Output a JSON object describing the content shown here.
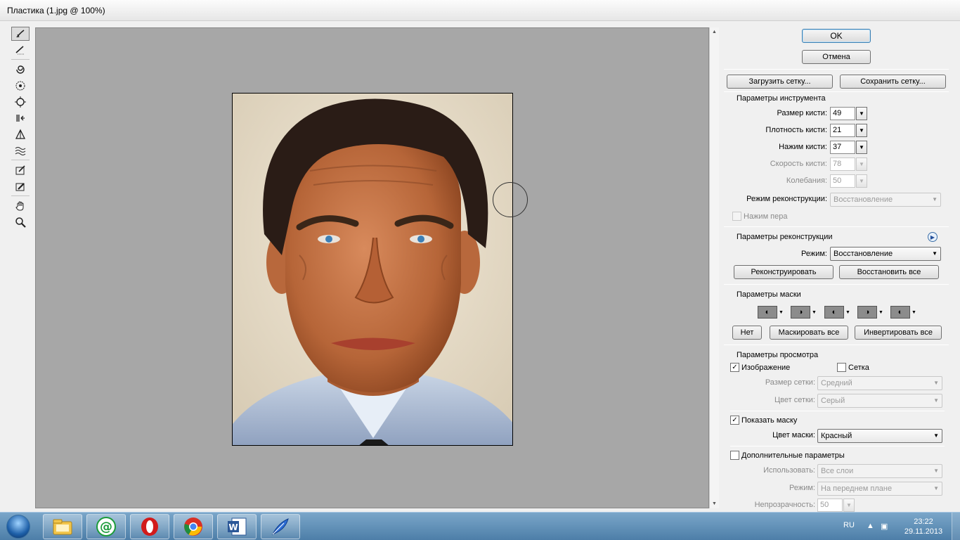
{
  "window": {
    "title": "Пластика (1.jpg @ 100%)"
  },
  "toolbar": {
    "tools": [
      {
        "name": "forward-warp-tool-icon",
        "active": true
      },
      {
        "name": "reconstruct-tool-icon"
      },
      {
        "name": "twirl-clockwise-tool-icon"
      },
      {
        "name": "pucker-tool-icon"
      },
      {
        "name": "bloat-tool-icon"
      },
      {
        "name": "push-left-tool-icon"
      },
      {
        "name": "mirror-tool-icon"
      },
      {
        "name": "turbulence-tool-icon"
      },
      {
        "name": "freeze-mask-tool-icon"
      },
      {
        "name": "thaw-mask-tool-icon"
      },
      {
        "name": "hand-tool-icon"
      },
      {
        "name": "zoom-tool-icon"
      }
    ]
  },
  "panel": {
    "ok_label": "OK",
    "cancel_label": "Отмена",
    "load_mesh_label": "Загрузить сетку...",
    "save_mesh_label": "Сохранить сетку...",
    "tool_options": {
      "title": "Параметры инструмента",
      "brush_size": {
        "label": "Размер кисти:",
        "value": "49"
      },
      "brush_density": {
        "label": "Плотность кисти:",
        "value": "21"
      },
      "brush_pressure": {
        "label": "Нажим кисти:",
        "value": "37"
      },
      "brush_rate": {
        "label": "Скорость кисти:",
        "value": "78"
      },
      "turbulent_jitter": {
        "label": "Колебания:",
        "value": "50"
      },
      "reconstruct_mode": {
        "label": "Режим реконструкции:",
        "value": "Восстановление"
      },
      "stylus_pressure_label": "Нажим пера"
    },
    "reconstruct_options": {
      "title": "Параметры реконструкции",
      "mode_label": "Режим:",
      "mode_value": "Восстановление",
      "reconstruct_label": "Реконструировать",
      "restore_all_label": "Восстановить все"
    },
    "mask_options": {
      "title": "Параметры маски",
      "none_label": "Нет",
      "mask_all_label": "Маскировать все",
      "invert_all_label": "Инвертировать все"
    },
    "view_options": {
      "title": "Параметры просмотра",
      "show_image_label": "Изображение",
      "show_image_checked": true,
      "show_mesh_label": "Сетка",
      "show_mesh_checked": false,
      "mesh_size": {
        "label": "Размер сетки:",
        "value": "Средний"
      },
      "mesh_color": {
        "label": "Цвет сетки:",
        "value": "Серый"
      },
      "show_mask_label": "Показать маску",
      "show_mask_checked": true,
      "mask_color": {
        "label": "Цвет маски:",
        "value": "Красный"
      },
      "show_backdrop_label": "Дополнительные параметры",
      "show_backdrop_checked": false,
      "use": {
        "label": "Использовать:",
        "value": "Все слои"
      },
      "backdrop_mode": {
        "label": "Режим:",
        "value": "На переднем плане"
      },
      "opacity": {
        "label": "Непрозрачность:",
        "value": "50"
      }
    }
  },
  "taskbar": {
    "apps": [
      "explorer-icon",
      "mail-agent-icon",
      "opera-icon",
      "chrome-icon",
      "word-icon",
      "photoshop-feather-icon"
    ],
    "language": "RU",
    "time": "23:22",
    "date": "29.11.2013"
  },
  "colors": {
    "canvas_bg": "#a7a7a7",
    "panel_bg": "#f0f0f0",
    "taskbar": "#5a8bb5"
  }
}
